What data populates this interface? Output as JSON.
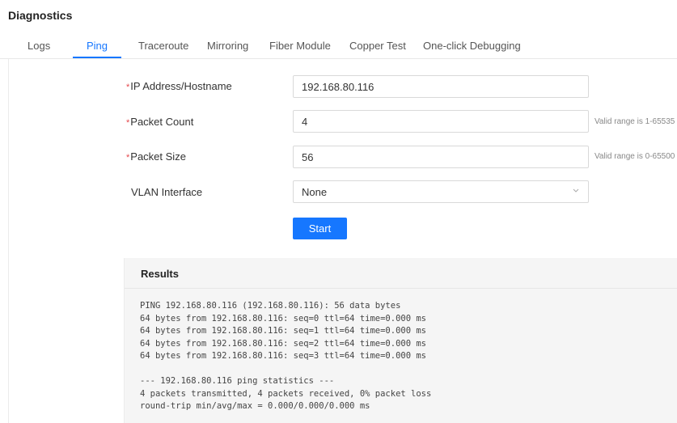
{
  "page": {
    "title": "Diagnostics"
  },
  "tabs": [
    {
      "label": "Logs"
    },
    {
      "label": "Ping"
    },
    {
      "label": "Traceroute"
    },
    {
      "label": "Mirroring"
    },
    {
      "label": "Fiber Module"
    },
    {
      "label": "Copper Test"
    },
    {
      "label": "One-click Debugging"
    }
  ],
  "active_tab": "Ping",
  "form": {
    "required_marker": "*",
    "ip": {
      "label": "IP Address/Hostname",
      "value": "192.168.80.116"
    },
    "count": {
      "label": "Packet Count",
      "value": "4",
      "hint": "Valid range is 1-65535"
    },
    "size": {
      "label": "Packet Size",
      "value": "56",
      "hint": "Valid range is 0-65500"
    },
    "vlan": {
      "label": "VLAN Interface",
      "value": "None"
    },
    "start_label": "Start"
  },
  "results": {
    "title": "Results",
    "output": "PING 192.168.80.116 (192.168.80.116): 56 data bytes\n64 bytes from 192.168.80.116: seq=0 ttl=64 time=0.000 ms\n64 bytes from 192.168.80.116: seq=1 ttl=64 time=0.000 ms\n64 bytes from 192.168.80.116: seq=2 ttl=64 time=0.000 ms\n64 bytes from 192.168.80.116: seq=3 ttl=64 time=0.000 ms\n\n--- 192.168.80.116 ping statistics ---\n4 packets transmitted, 4 packets received, 0% packet loss\nround-trip min/avg/max = 0.000/0.000/0.000 ms"
  },
  "colors": {
    "accent": "#1677ff",
    "required": "#e5484d",
    "results_bg": "#f5f5f5"
  },
  "icons": {
    "select_arrow": "chevron-down-icon"
  }
}
